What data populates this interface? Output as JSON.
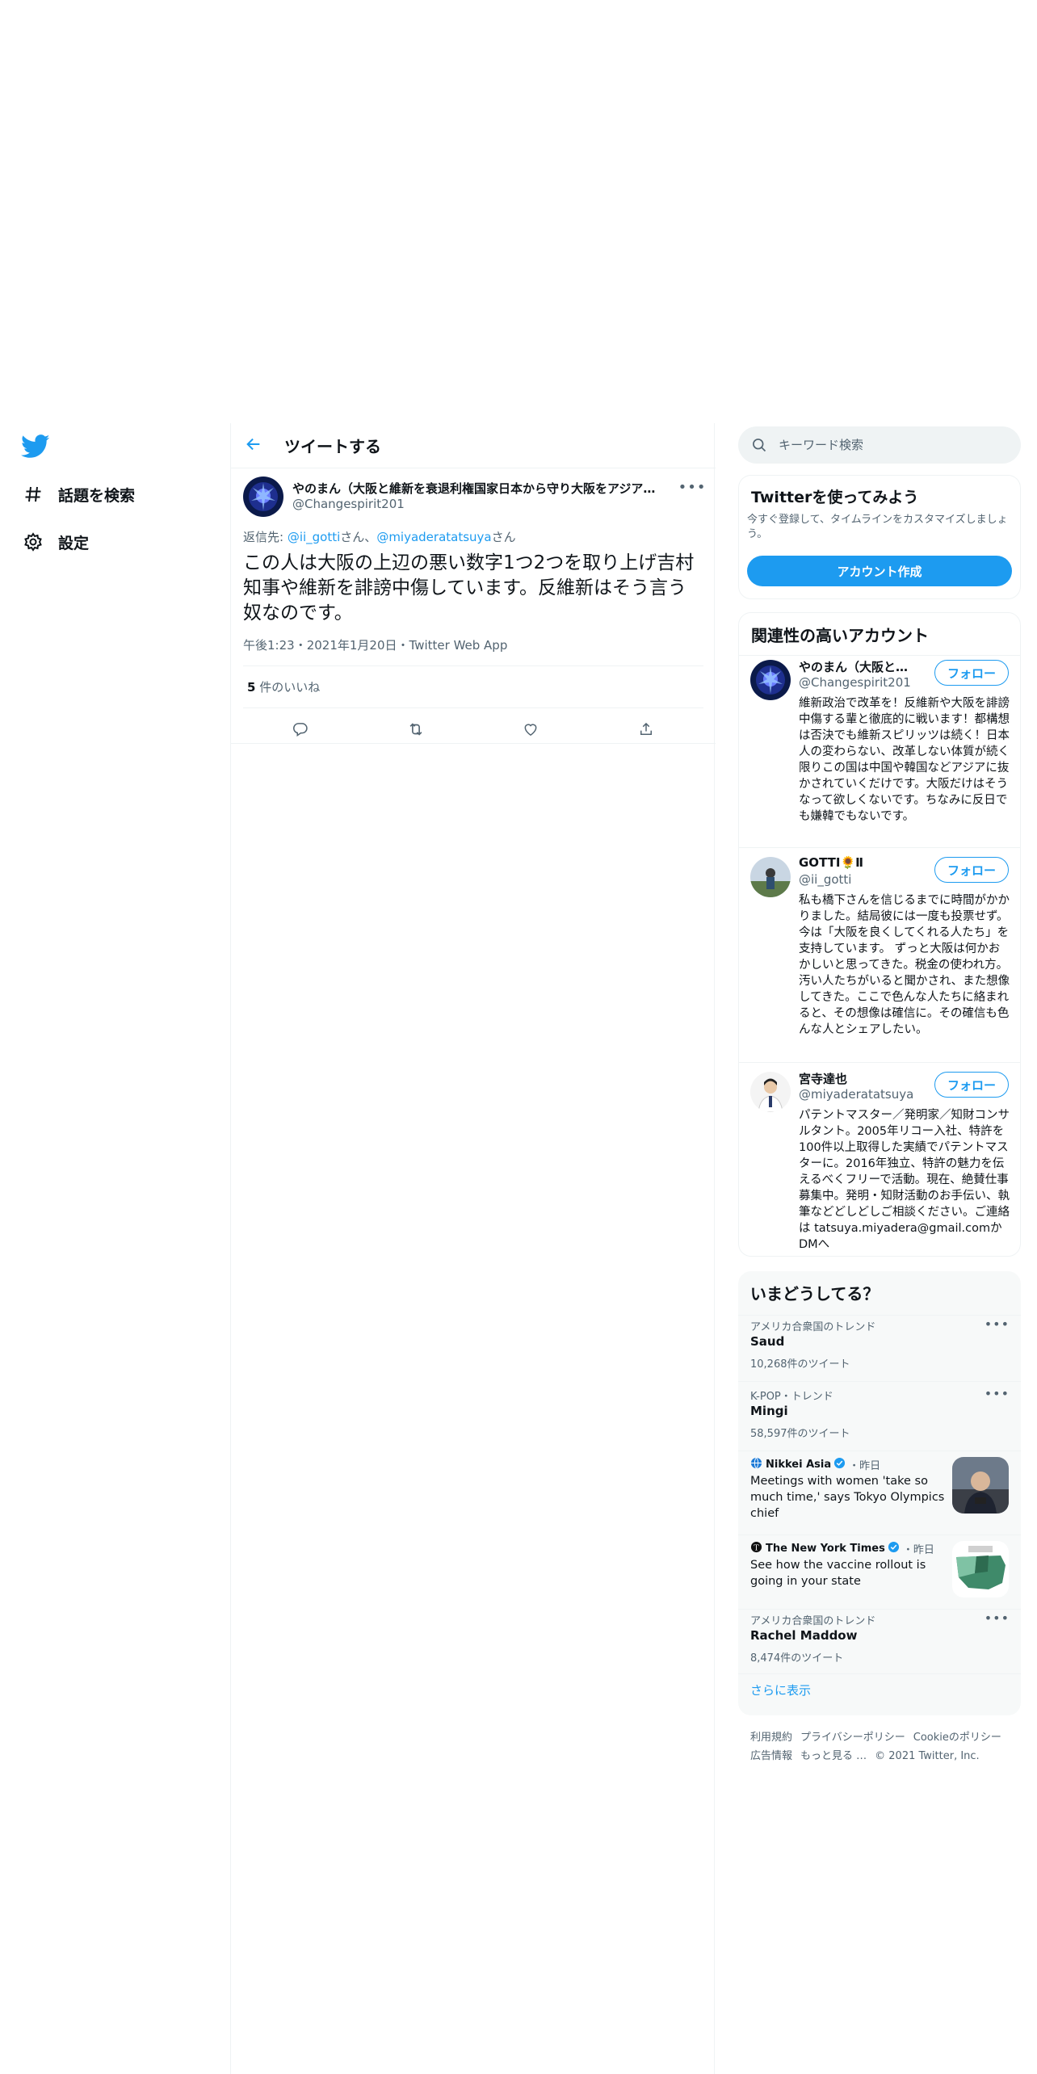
{
  "nav": {
    "explore_label": "話題を検索",
    "settings_label": "設定"
  },
  "header": {
    "title": "ツイートする"
  },
  "tweet": {
    "author_name": "やのまん（大阪と維新を衰退利権国家日本から守り大阪をアジアのハブ都市にする市民の会）",
    "author_handle": "@Changespirit201",
    "reply_prefix": "返信先: ",
    "reply_user1": "@ii_gotti",
    "reply_san1": "さん、",
    "reply_user2": "@miyaderatatsuya",
    "reply_san2": "さん",
    "text": "この人は大阪の上辺の悪い数字1つ2つを取り上げ吉村知事や維新を誹謗中傷しています。反維新はそう言う奴なのです。",
    "time": "午後1:23",
    "dot1": "・",
    "date": "2021年1月20日",
    "dot2": "・",
    "source": "Twitter Web App",
    "likes_count": "5",
    "likes_label": " 件のいいね"
  },
  "search": {
    "placeholder": "キーワード検索"
  },
  "signup": {
    "title": "Twitterを使ってみよう",
    "desc": "今すぐ登録して、タイムラインをカスタマイズしましょう。",
    "button": "アカウント作成"
  },
  "related": {
    "title": "関連性の高いアカウント",
    "follow_label": "フォロー",
    "accounts": [
      {
        "name": "やのまん（大阪と維新を衰退利権国家日本から守り大阪をアジアのハブ都市にする市民の会）",
        "handle": "@Changespirit201",
        "bio": "維新政治で改革を！反維新や大阪を誹謗中傷する輩と徹底的に戦います！都構想は否決でも維新スピリッツは続く！日本人の変わらない、改革しない体質が続く限りこの国は中国や韓国などアジアに抜かされていくだけです。大阪だけはそうなって欲しくないです。ちなみに反日でも嫌韓でもないです。"
      },
      {
        "name": "GOTTI🌻Ⅱ",
        "handle": "@ii_gotti",
        "bio": "私も橋下さんを信じるまでに時間がかかりました。結局彼には一度も投票せず。 今は「大阪を良くしてくれる人たち」を支持しています。 ずっと大阪は何かおかしいと思ってきた。税金の使われ方。汚い人たちがいると聞かされ、また想像してきた。ここで色んな人たちに絡まれると、その想像は確信に。その確信も色んな人とシェアしたい。"
      },
      {
        "name": "宮寺達也",
        "handle": "@miyaderatatsuya",
        "bio": "パテントマスター／発明家／知財コンサルタント。2005年リコー入社、特許を100件以上取得した実績でパテントマスターに。2016年独立、特許の魅力を伝えるべくフリーで活動。現在、絶賛仕事募集中。発明・知財活動のお手伝い、執筆などどしどしご相談ください。ご連絡は tatsuya.miyadera@gmail.comかDMへ"
      }
    ]
  },
  "trends": {
    "title": "いまどうしてる？",
    "items": [
      {
        "context": "アメリカ合衆国のトレンド",
        "name": "Saud",
        "count": "10,268件のツイート"
      },
      {
        "context": "K-POP・トレンド",
        "name": "Mingi",
        "count": "58,597件のツイート"
      }
    ],
    "news": [
      {
        "source": "Nikkei Asia",
        "when": "・昨日",
        "headline": "Meetings with women 'take so much time,' says Tokyo Olympics chief"
      },
      {
        "source": "The New York Times",
        "when": "・昨日",
        "headline": "See how the vaccine rollout is going in your state"
      }
    ],
    "last": {
      "context": "アメリカ合衆国のトレンド",
      "name": "Rachel Maddow",
      "count": "8,474件のツイート"
    },
    "show_more": "さらに表示"
  },
  "footer": {
    "terms": "利用規約",
    "privacy": "プライバシーポリシー",
    "cookie": "Cookieのポリシー",
    "ads": "広告情報",
    "more": "もっと見る …",
    "copyright": "© 2021 Twitter, Inc."
  },
  "colors": {
    "accent": "#1d9bf0",
    "text": "#0f1419",
    "secondary": "#536471",
    "border": "#eff3f4"
  },
  "icons": [
    "twitter-logo-icon",
    "hashtag-icon",
    "gear-icon",
    "back-arrow-icon",
    "more-icon",
    "reply-icon",
    "retweet-icon",
    "like-icon",
    "share-icon",
    "search-icon",
    "verified-icon"
  ]
}
